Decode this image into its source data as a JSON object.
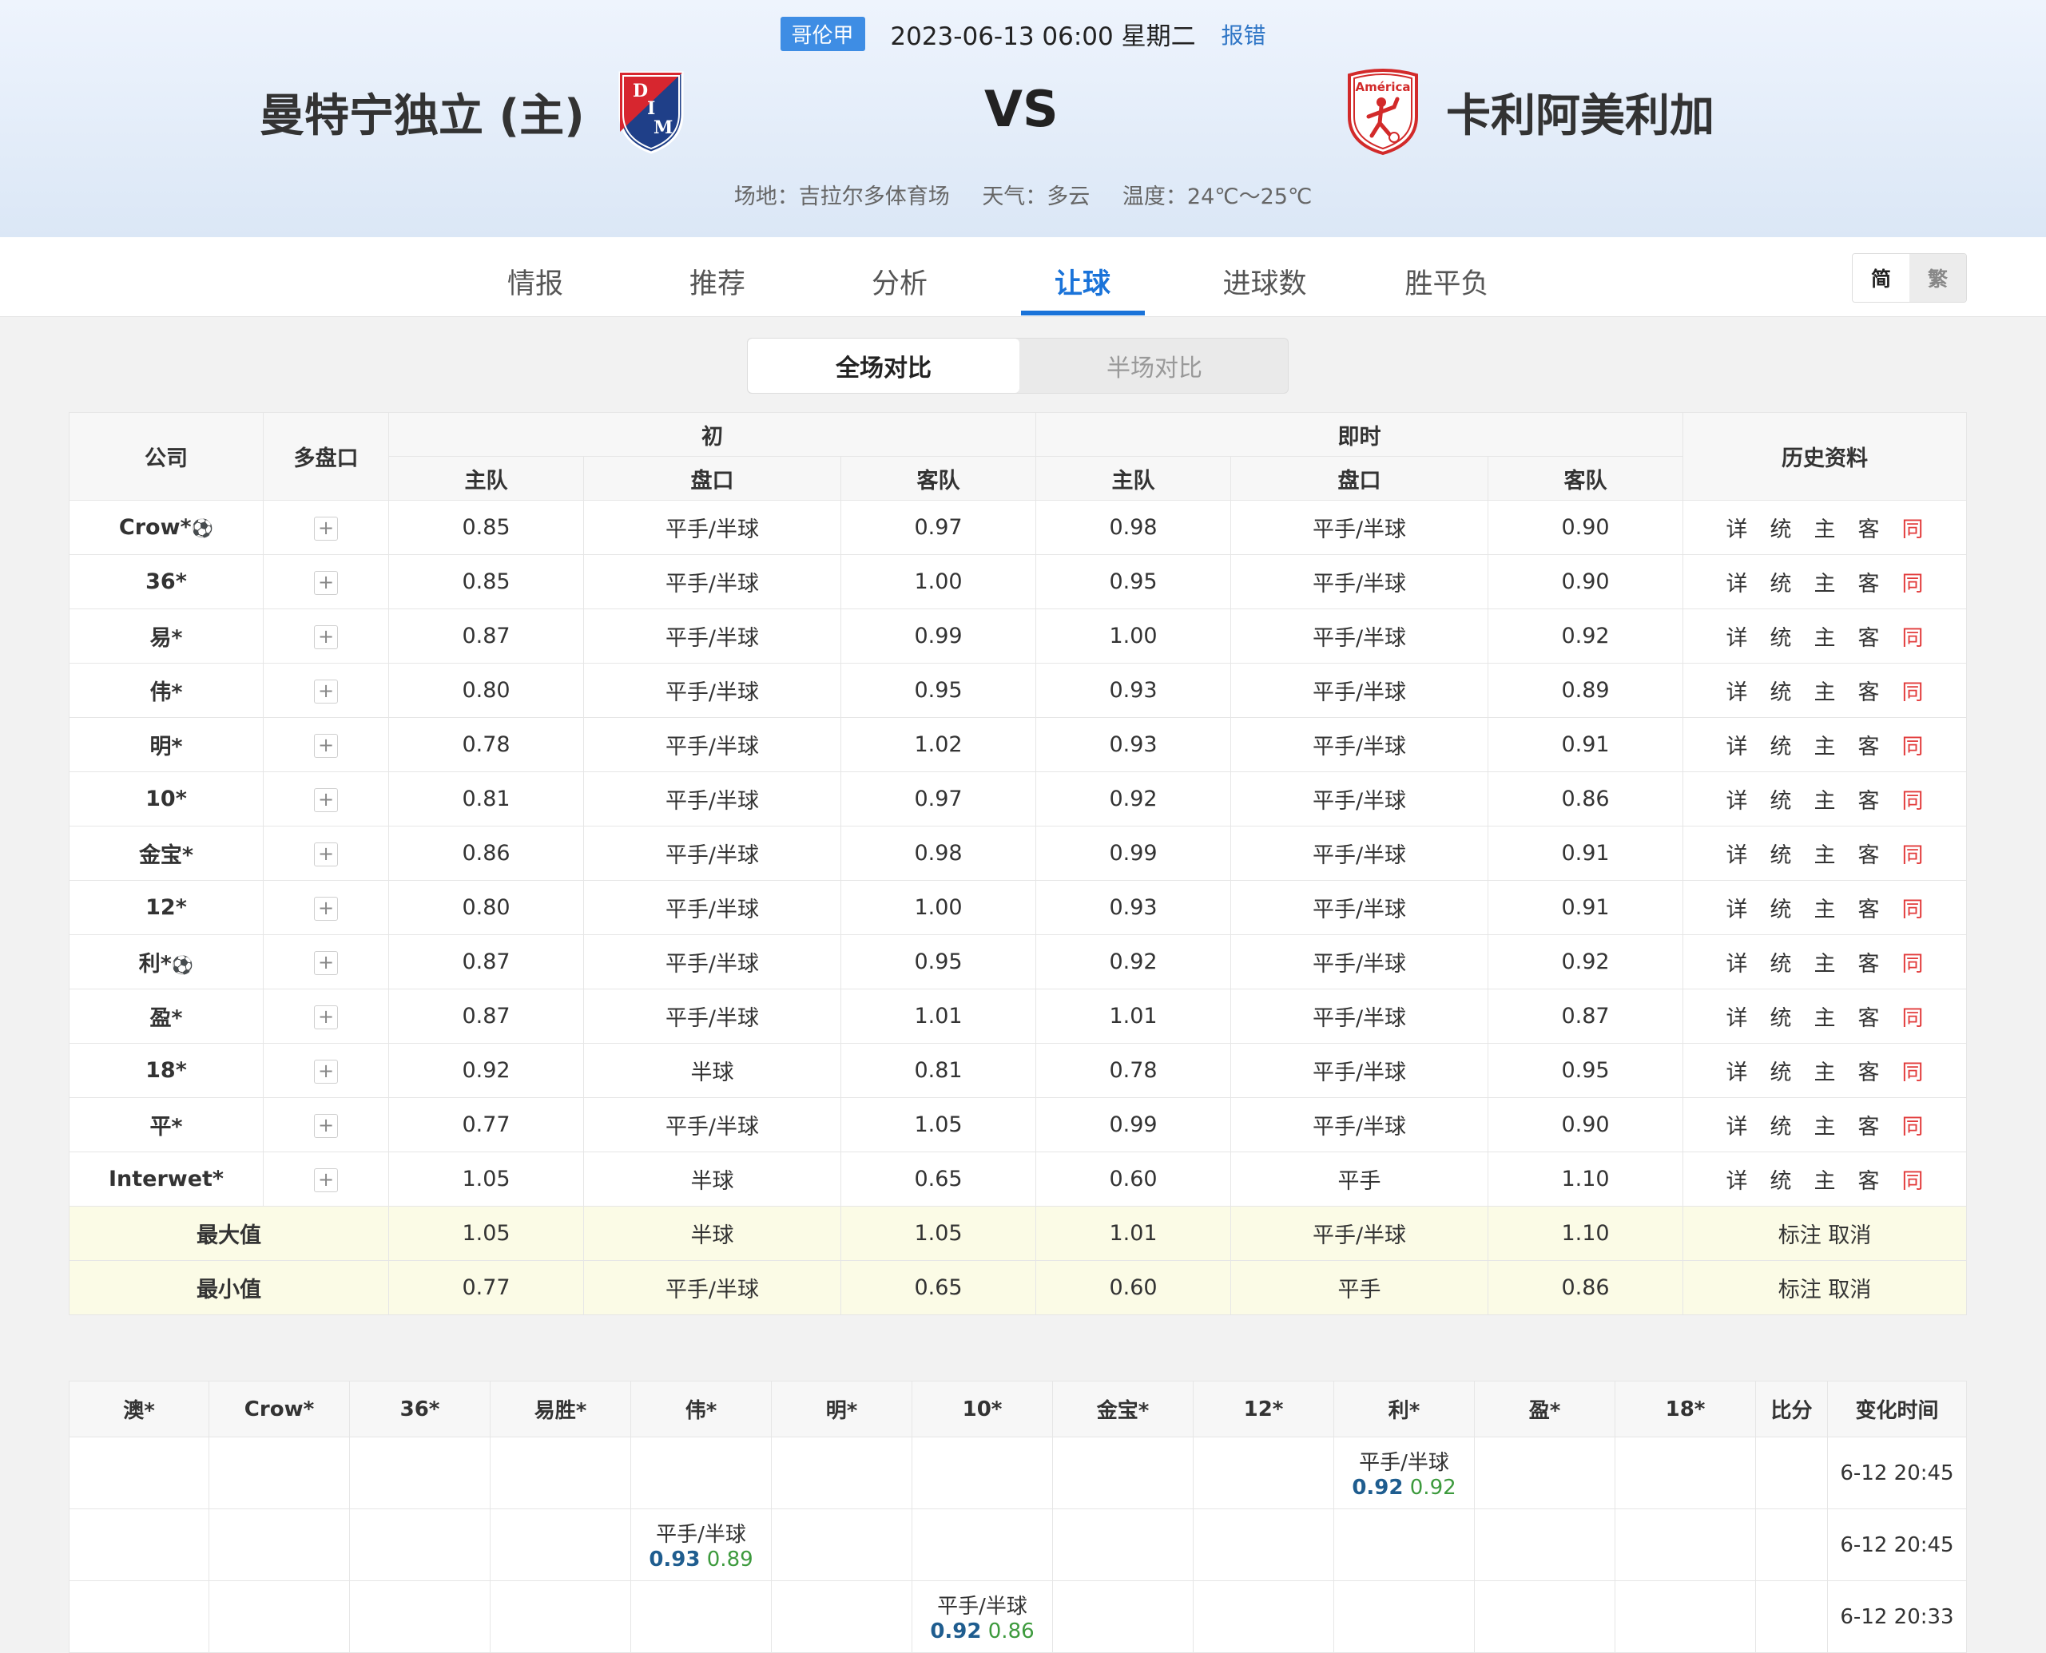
{
  "match": {
    "league": "哥伦甲",
    "datetime": "2023-06-13 06:00 星期二",
    "report_error": "报错",
    "home_team": "曼特宁独立 (主)",
    "away_team": "卡利阿美利加",
    "vs": "VS",
    "away_logo_text": "América",
    "home_logo_letters": [
      "D",
      "I",
      "M"
    ],
    "venue": "场地：吉拉尔多体育场",
    "weather": "天气：多云",
    "temperature": "温度：24℃～25℃"
  },
  "nav": {
    "tabs": [
      "情报",
      "推荐",
      "分析",
      "让球",
      "进球数",
      "胜平负"
    ],
    "active": "让球",
    "lang_simplified": "简",
    "lang_traditional": "繁"
  },
  "toggle": {
    "full": "全场对比",
    "half": "半场对比"
  },
  "odds_table": {
    "headers": {
      "company": "公司",
      "multi": "多盘口",
      "initial": "初",
      "live": "即时",
      "history": "历史资料",
      "home": "主队",
      "line": "盘口",
      "away": "客队"
    },
    "history_links": [
      "详",
      "统",
      "主",
      "客",
      "同"
    ],
    "plus": "+",
    "rows": [
      {
        "company": "Crow*",
        "ball": "⚽",
        "i_home": "0.85",
        "i_line": "平手/半球",
        "i_away": "0.97",
        "l_home": "0.98",
        "l_line": "平手/半球",
        "l_away": "0.90"
      },
      {
        "company": "36*",
        "ball": "",
        "i_home": "0.85",
        "i_line": "平手/半球",
        "i_away": "1.00",
        "l_home": "0.95",
        "l_line": "平手/半球",
        "l_away": "0.90"
      },
      {
        "company": "易*",
        "ball": "",
        "i_home": "0.87",
        "i_line": "平手/半球",
        "i_away": "0.99",
        "l_home": "1.00",
        "l_line": "平手/半球",
        "l_away": "0.92"
      },
      {
        "company": "伟*",
        "ball": "",
        "i_home": "0.80",
        "i_line": "平手/半球",
        "i_away": "0.95",
        "l_home": "0.93",
        "l_line": "平手/半球",
        "l_away": "0.89"
      },
      {
        "company": "明*",
        "ball": "",
        "i_home": "0.78",
        "i_line": "平手/半球",
        "i_away": "1.02",
        "l_home": "0.93",
        "l_line": "平手/半球",
        "l_away": "0.91"
      },
      {
        "company": "10*",
        "ball": "",
        "i_home": "0.81",
        "i_line": "平手/半球",
        "i_away": "0.97",
        "l_home": "0.92",
        "l_line": "平手/半球",
        "l_away": "0.86"
      },
      {
        "company": "金宝*",
        "ball": "",
        "i_home": "0.86",
        "i_line": "平手/半球",
        "i_away": "0.98",
        "l_home": "0.99",
        "l_line": "平手/半球",
        "l_away": "0.91"
      },
      {
        "company": "12*",
        "ball": "",
        "i_home": "0.80",
        "i_line": "平手/半球",
        "i_away": "1.00",
        "l_home": "0.93",
        "l_line": "平手/半球",
        "l_away": "0.91"
      },
      {
        "company": "利*",
        "ball": "⚽",
        "i_home": "0.87",
        "i_line": "平手/半球",
        "i_away": "0.95",
        "l_home": "0.92",
        "l_line": "平手/半球",
        "l_away": "0.92"
      },
      {
        "company": "盈*",
        "ball": "",
        "i_home": "0.87",
        "i_line": "平手/半球",
        "i_away": "1.01",
        "l_home": "1.01",
        "l_line": "平手/半球",
        "l_away": "0.87"
      },
      {
        "company": "18*",
        "ball": "",
        "i_home": "0.92",
        "i_line": "半球",
        "i_away": "0.81",
        "l_home": "0.78",
        "l_line": "平手/半球",
        "l_away": "0.95"
      },
      {
        "company": "平*",
        "ball": "",
        "i_home": "0.77",
        "i_line": "平手/半球",
        "i_away": "1.05",
        "l_home": "0.99",
        "l_line": "平手/半球",
        "l_away": "0.90"
      },
      {
        "company": "Interwet*",
        "ball": "",
        "i_home": "1.05",
        "i_line": "半球",
        "i_away": "0.65",
        "l_home": "0.60",
        "l_line": "平手",
        "l_away": "1.10"
      }
    ],
    "summary": [
      {
        "label": "最大值",
        "i_home": "1.05",
        "i_line": "半球",
        "i_away": "1.05",
        "l_home": "1.01",
        "l_line": "平手/半球",
        "l_away": "1.10",
        "actions": "标注 取消"
      },
      {
        "label": "最小值",
        "i_home": "0.77",
        "i_line": "平手/半球",
        "i_away": "0.65",
        "l_home": "0.60",
        "l_line": "平手",
        "l_away": "0.86",
        "actions": "标注 取消"
      }
    ]
  },
  "change_table": {
    "headers": [
      "澳*",
      "Crow*",
      "36*",
      "易胜*",
      "伟*",
      "明*",
      "10*",
      "金宝*",
      "12*",
      "利*",
      "盈*",
      "18*",
      "比分",
      "变化时间"
    ],
    "rows": [
      {
        "col": 9,
        "line": "平手/半球",
        "home": "0.92",
        "away": "0.92",
        "time": "6-12 20:45"
      },
      {
        "col": 4,
        "line": "平手/半球",
        "home": "0.93",
        "away": "0.89",
        "time": "6-12 20:45"
      },
      {
        "col": 6,
        "line": "平手/半球",
        "home": "0.92",
        "away": "0.86",
        "time": "6-12 20:33"
      }
    ]
  },
  "colors": {
    "accent": "#1a73d9",
    "league_badge": "#3e8de4",
    "history_same": "#e23b3b",
    "change_home": "#1f5d8f",
    "change_away": "#3d9a3d",
    "summary_bg": "#fbfbe6"
  }
}
